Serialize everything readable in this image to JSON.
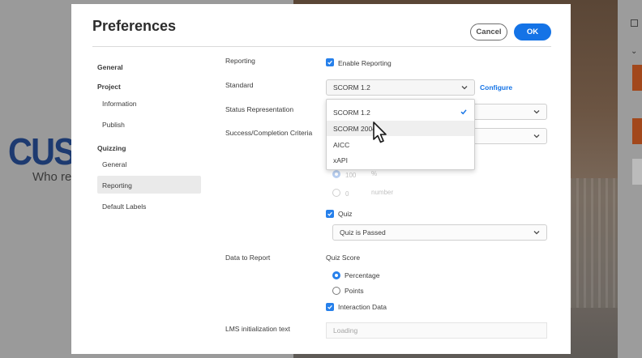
{
  "background": {
    "logo_text": "CUST",
    "tagline": "Who re"
  },
  "dialog": {
    "title": "Preferences",
    "cancel_label": "Cancel",
    "ok_label": "OK"
  },
  "nav": {
    "general": "General",
    "project": "Project",
    "information": "Information",
    "publish": "Publish",
    "quizzing": "Quizzing",
    "quiz_general": "General",
    "reporting": "Reporting",
    "default_labels": "Default Labels",
    "selected": "Reporting"
  },
  "reporting": {
    "reporting_label": "Reporting",
    "enable_reporting": "Enable Reporting",
    "enable_reporting_checked": true,
    "standard_label": "Standard",
    "standard_value": "SCORM 1.2",
    "configure_link": "Configure",
    "status_label": "Status Representation",
    "criteria_label": "Success/Completion Criteria",
    "percent_value": "100",
    "percent_unit": "%",
    "number_value": "0",
    "number_unit": "number",
    "quiz_label": "Quiz",
    "quiz_checked": true,
    "quiz_select_value": "Quiz is Passed",
    "data_to_report_label": "Data to Report",
    "quiz_score_label": "Quiz Score",
    "percentage_label": "Percentage",
    "points_label": "Points",
    "score_selected": "Percentage",
    "interaction_data_label": "Interaction Data",
    "interaction_data_checked": true,
    "lms_init_label": "LMS initialization text",
    "lms_init_value": "Loading"
  },
  "standard_dropdown": {
    "open": true,
    "options": [
      "SCORM 1.2",
      "SCORM 2004",
      "AICC",
      "xAPI"
    ],
    "selected": "SCORM 1.2",
    "hovered": "SCORM 2004"
  },
  "colors": {
    "accent": "#1473e6",
    "checkbox": "#2680eb"
  }
}
